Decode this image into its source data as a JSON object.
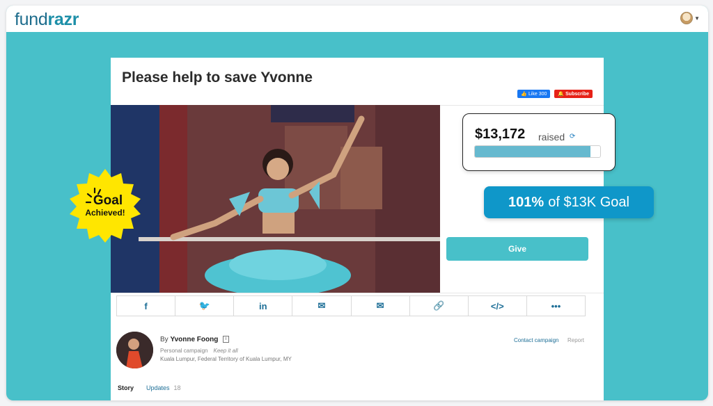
{
  "app": {
    "logo_fund": "fund",
    "logo_razr": "razr"
  },
  "campaign": {
    "title": "Please help to save Yvonne",
    "fb_like": "Like 300",
    "subscribe": "Subscribe",
    "raised_amount": "$13,172",
    "raised_label": "raised",
    "progress_fraction": 1.0,
    "goal_percent": "101%",
    "goal_text": "of $13K Goal",
    "give_label": "Give",
    "badge_line1": "Goal",
    "badge_line2": "Achieved!"
  },
  "share": {
    "buttons": [
      {
        "name": "facebook-icon",
        "glyph": "f"
      },
      {
        "name": "twitter-icon",
        "glyph": "🐦"
      },
      {
        "name": "linkedin-icon",
        "glyph": "in"
      },
      {
        "name": "messenger-icon",
        "glyph": "✉"
      },
      {
        "name": "email-icon",
        "glyph": "✉"
      },
      {
        "name": "link-icon",
        "glyph": "🔗"
      },
      {
        "name": "embed-icon",
        "glyph": "</>"
      },
      {
        "name": "more-icon",
        "glyph": "•••"
      }
    ]
  },
  "owner": {
    "by": "By",
    "name": "Yvonne Foong",
    "info": "i",
    "type": "Personal campaign",
    "keep": "Keep it all",
    "location": "Kuala Lumpur, Federal Territory of Kuala Lumpur, MY",
    "contact": "Contact campaign",
    "report": "Report"
  },
  "tabs": {
    "story": "Story",
    "updates": "Updates",
    "updates_count": "18"
  },
  "colors": {
    "background": "#48c0c9",
    "brand": "#1d6c8c",
    "goal_pill": "#0f97c9",
    "badge": "#ffe600"
  }
}
